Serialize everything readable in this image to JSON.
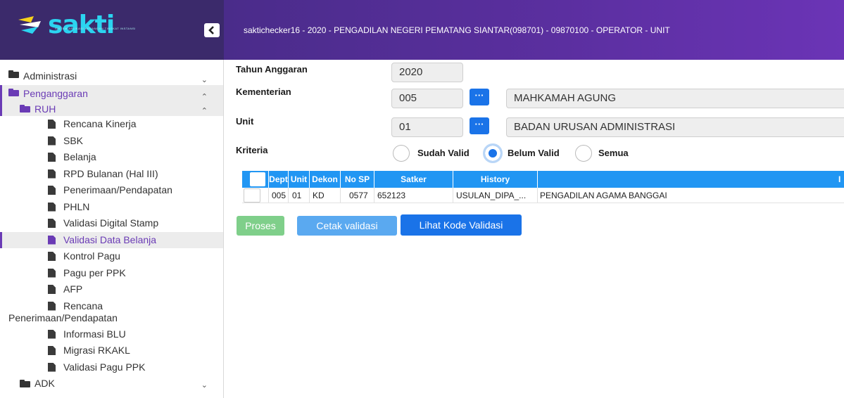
{
  "app": {
    "logo_text": "sakti",
    "logo_tagline": "SISTEM APLIKASI KEUANGAN TINGKAT INSTANSI",
    "header_title": "saktichecker16 - 2020 - PENGADILAN NEGERI PEMATANG SIANTAR(098701) - 09870100 - OPERATOR - UNIT"
  },
  "colors": {
    "header": "#4a2c8a",
    "accent": "#6a3bb5",
    "primary": "#1a73e8",
    "success": "#7fcf8a"
  },
  "sidebar": {
    "administrasi": "Administrasi",
    "penganggaran": "Penganggaran",
    "ruh": "RUH",
    "items": [
      "Rencana Kinerja",
      "SBK",
      "Belanja",
      "RPD Bulanan (Hal III)",
      "Penerimaan/Pendapatan",
      "PHLN",
      "Validasi Digital Stamp",
      "Validasi Data Belanja",
      "Kontrol Pagu",
      "Pagu per PPK",
      "AFP"
    ],
    "rencana_line1": "Rencana",
    "rencana_line2": "Penerimaan/Pendapatan",
    "items2": [
      "Informasi BLU",
      "Migrasi RKAKL",
      "Validasi Pagu PPK"
    ],
    "adk": "ADK"
  },
  "form": {
    "tahun_label": "Tahun Anggaran",
    "tahun_value": "2020",
    "kementerian_label": "Kementerian",
    "kementerian_code": "005",
    "kementerian_name": "MAHKAMAH AGUNG",
    "unit_label": "Unit",
    "unit_code": "01",
    "unit_name": "BADAN URUSAN ADMINISTRASI",
    "lookup_label": "···",
    "kriteria_label": "Kriteria",
    "kriteria_options": [
      "Sudah Valid",
      "Belum Valid",
      "Semua"
    ],
    "kriteria_selected": "Belum Valid"
  },
  "table": {
    "headers": [
      "Dept",
      "Unit",
      "Dekon",
      "No SP",
      "Satker",
      "History",
      "",
      "I"
    ],
    "rows": [
      [
        "005",
        "01",
        "KD",
        "0577",
        "652123",
        "USULAN_DIPA_...",
        "PENGADILAN AGAMA BANGGAI"
      ]
    ]
  },
  "buttons": {
    "proses": "Proses",
    "cetak": "Cetak validasi",
    "lihat": "Lihat Kode Validasi"
  }
}
